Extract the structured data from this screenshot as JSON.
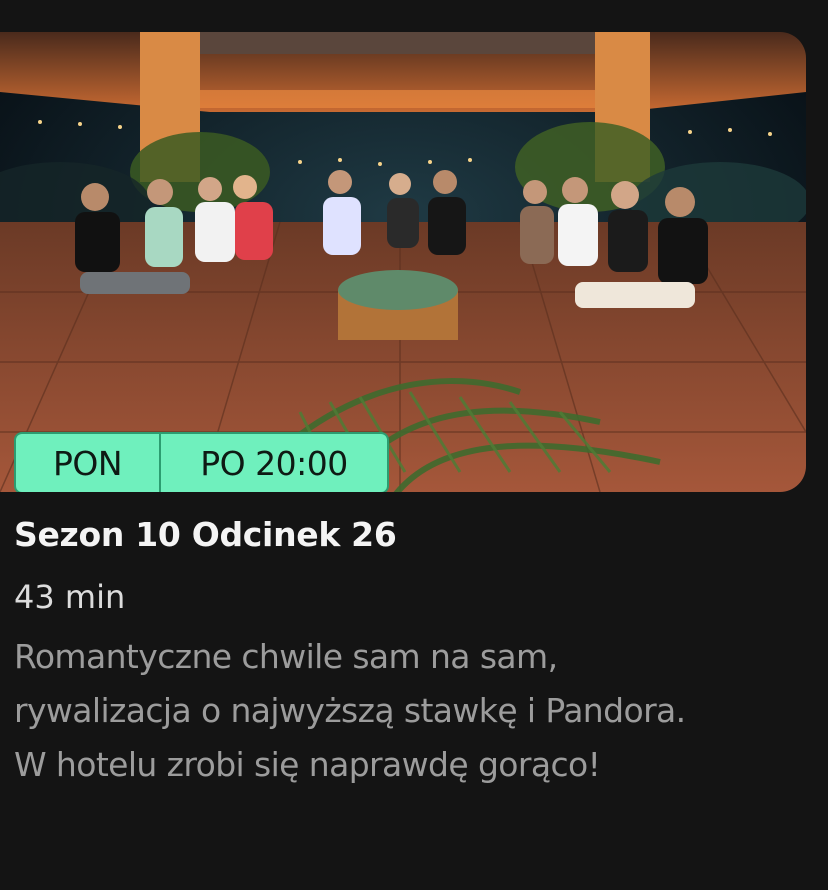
{
  "episode": {
    "thumbnail_icon": "episode-still-image",
    "air_day": "PON",
    "air_time": "PO 20:00",
    "title": "Sezon 10 Odcinek 26",
    "duration": "43 min",
    "description_lines": [
      "Romantyczne chwile sam na sam,",
      "rywalizacja o najwyższą stawkę i Pandora.",
      "W hotelu zrobi się naprawdę gorąco!"
    ]
  },
  "colors": {
    "background": "#141414",
    "badge_fill": "#6ff0bd",
    "badge_border": "#2c9d71",
    "title": "#f4f4f4",
    "duration": "#dcdcdc",
    "description": "#9c9c9c"
  }
}
